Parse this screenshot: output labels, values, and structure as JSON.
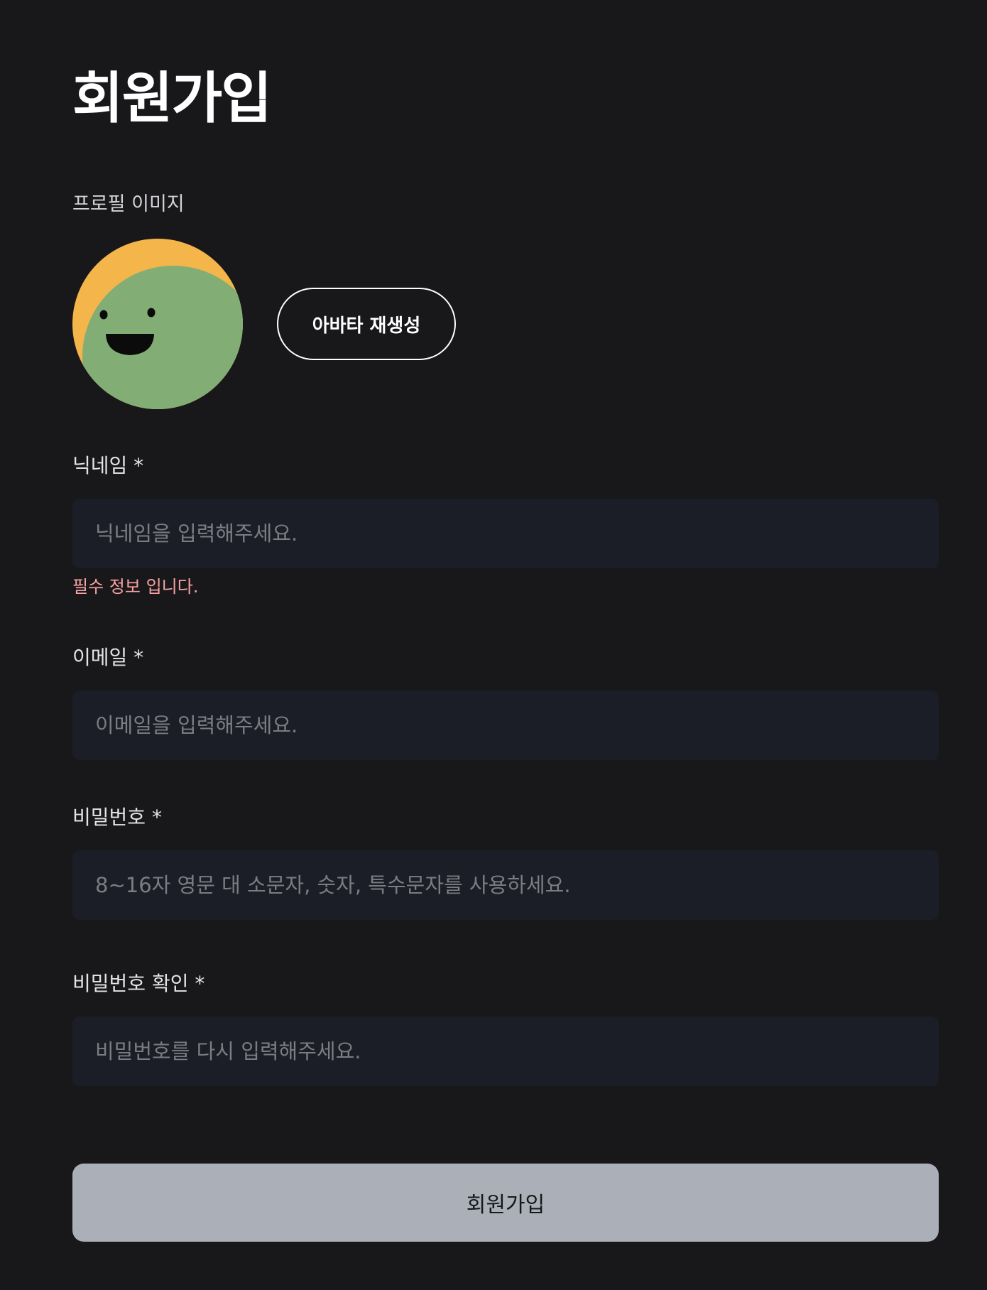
{
  "page": {
    "title": "회원가입"
  },
  "profile": {
    "label": "프로필 이미지",
    "regenerate_label": "아바타 재생성",
    "avatar_colors": {
      "background": "#f4b54a",
      "face": "#82ae76",
      "features": "#0b0b0b"
    }
  },
  "fields": {
    "nickname": {
      "label": "닉네임 *",
      "placeholder": "닉네임을 입력해주세요.",
      "error": "필수 정보 입니다."
    },
    "email": {
      "label": "이메일 *",
      "placeholder": "이메일을 입력해주세요."
    },
    "password": {
      "label": "비밀번호 *",
      "placeholder": "8~16자 영문 대 소문자, 숫자, 특수문자를 사용하세요."
    },
    "password_confirm": {
      "label": "비밀번호 확인 *",
      "placeholder": "비밀번호를 다시 입력해주세요."
    }
  },
  "submit": {
    "label": "회원가입"
  },
  "colors": {
    "background": "#18181b",
    "input_background": "#1b1e26",
    "error": "#f8a3a3",
    "submit_background": "#abb0b8"
  }
}
